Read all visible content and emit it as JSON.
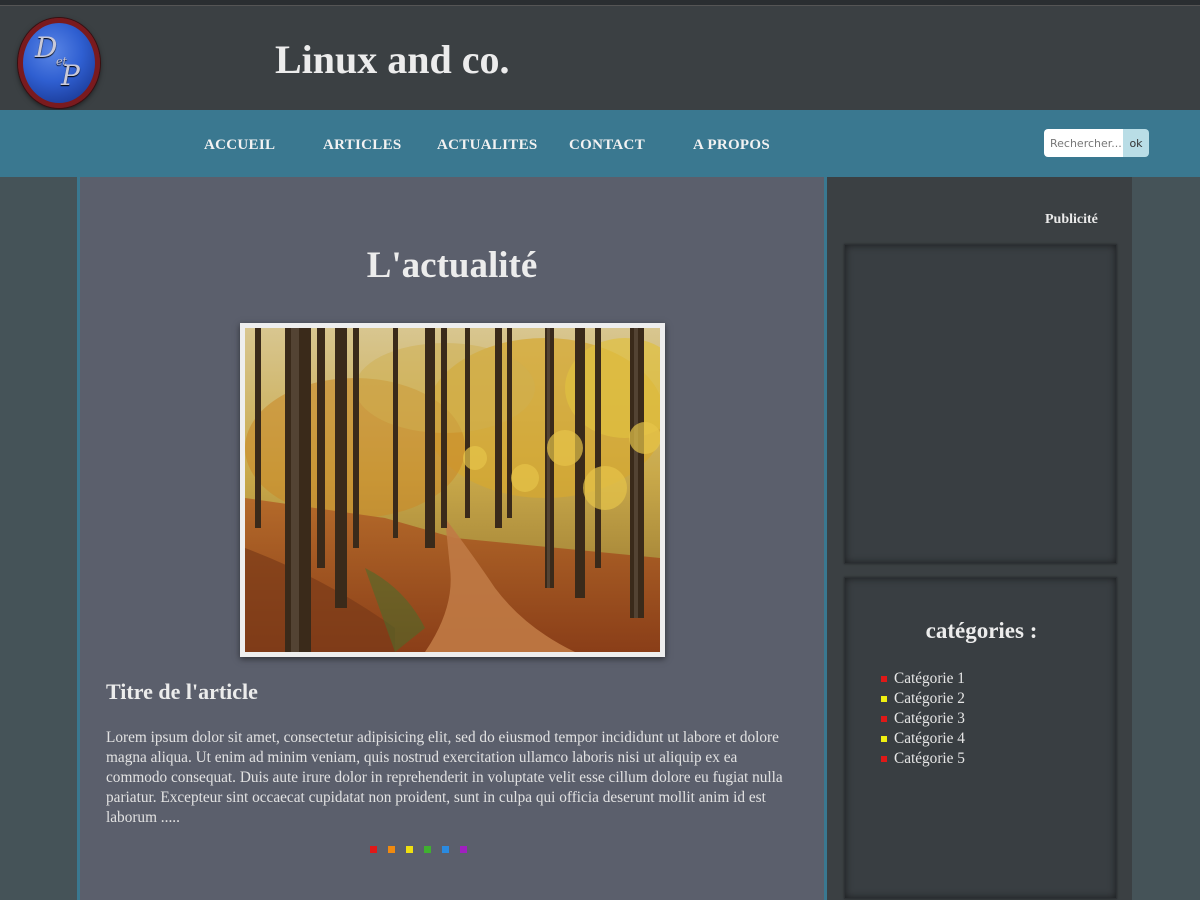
{
  "site": {
    "title": "Linux and co.",
    "logo_letters": [
      "D",
      "et",
      "P"
    ]
  },
  "nav": {
    "items": [
      {
        "label": "ACCUEIL"
      },
      {
        "label": "ARTICLES"
      },
      {
        "label": "ACTUALITES"
      },
      {
        "label": "CONTACT"
      },
      {
        "label": "A PROPOS"
      }
    ]
  },
  "search": {
    "placeholder": "Rechercher...",
    "button_label": "ok"
  },
  "main": {
    "heading": "L'actualité",
    "article": {
      "title": "Titre de l'article",
      "text": "Lorem ipsum dolor sit amet, consectetur adipisicing elit, sed do eiusmod tempor incididunt ut labore et dolore magna aliqua. Ut enim ad minim veniam, quis nostrud exercitation ullamco laboris nisi ut aliquip ex ea commodo consequat. Duis aute irure dolor in reprehenderit in voluptate velit esse cillum dolore eu fugiat nulla pariatur. Excepteur sint occaecat cupidatat non proident, sunt in culpa qui officia deserunt mollit anim id est laborum ....."
    },
    "pagination_dot_colors": [
      "#e01818",
      "#f08a10",
      "#f0e010",
      "#40b030",
      "#2a8ae0",
      "#a020c0"
    ]
  },
  "sidebar": {
    "ad_label": "Publicité",
    "categories_title": "catégories :",
    "categories": [
      {
        "label": "Catégorie 1",
        "color": "#e01818"
      },
      {
        "label": "Catégorie 2",
        "color": "#f0f010"
      },
      {
        "label": "Catégorie 3",
        "color": "#e01818"
      },
      {
        "label": "Catégorie 4",
        "color": "#f0f010"
      },
      {
        "label": "Catégorie 5",
        "color": "#e01818"
      }
    ]
  },
  "colors": {
    "header_bg": "#3b4043",
    "nav_bg": "#3a7890",
    "content_bg": "#5b5f6c",
    "page_bg": "#455358"
  }
}
